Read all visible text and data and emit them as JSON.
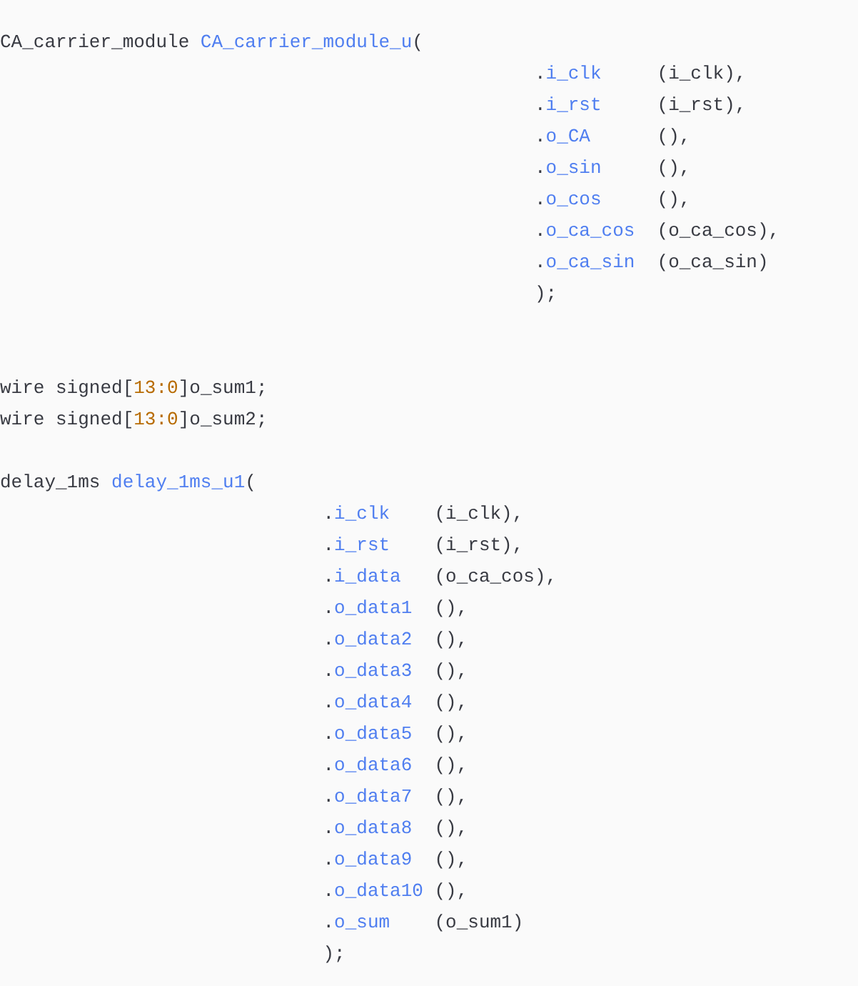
{
  "code_block": [
    {
      "kind": "instance",
      "head": [
        {
          "text": "CA_carrier_module",
          "kind": "type"
        },
        {
          "text": "CA_carrier_module_u",
          "kind": "ident"
        },
        {
          "text": "(",
          "kind": "plain"
        }
      ],
      "ports": [
        {
          "dot": ".",
          "name": "i_clk",
          "signal": "(i_clk),"
        },
        {
          "dot": ".",
          "name": "i_rst",
          "signal": "(i_rst),"
        },
        {
          "dot": ".",
          "name": "o_CA",
          "signal": "(),"
        },
        {
          "dot": ".",
          "name": "o_sin",
          "signal": "(),"
        },
        {
          "dot": ".",
          "name": "o_cos",
          "signal": "(),"
        },
        {
          "dot": ".",
          "name": "o_ca_cos",
          "signal": "(o_ca_cos),"
        },
        {
          "dot": ".",
          "name": "o_ca_sin",
          "signal": "(o_ca_sin)"
        }
      ],
      "close": ");"
    },
    {
      "kind": "blank"
    },
    {
      "kind": "blank"
    },
    {
      "kind": "line",
      "tokens": [
        {
          "text": "wire signed[",
          "kind": "plain"
        },
        {
          "text": "13:0",
          "kind": "number"
        },
        {
          "text": "]o_sum1;",
          "kind": "plain"
        }
      ]
    },
    {
      "kind": "line",
      "tokens": [
        {
          "text": "wire signed[",
          "kind": "plain"
        },
        {
          "text": "13:0",
          "kind": "number"
        },
        {
          "text": "]o_sum2;",
          "kind": "plain"
        }
      ]
    },
    {
      "kind": "blank"
    },
    {
      "kind": "instance",
      "head": [
        {
          "text": "delay_1ms",
          "kind": "type"
        },
        {
          "text": "delay_1ms_u1",
          "kind": "ident"
        },
        {
          "text": "(",
          "kind": "plain"
        }
      ],
      "ports": [
        {
          "dot": ".",
          "name": "i_clk",
          "signal": "(i_clk),"
        },
        {
          "dot": ".",
          "name": "i_rst",
          "signal": "(i_rst),"
        },
        {
          "dot": ".",
          "name": "i_data",
          "signal": "(o_ca_cos),"
        },
        {
          "dot": ".",
          "name": "o_data1",
          "signal": "(),"
        },
        {
          "dot": ".",
          "name": "o_data2",
          "signal": "(),"
        },
        {
          "dot": ".",
          "name": "o_data3",
          "signal": "(),"
        },
        {
          "dot": ".",
          "name": "o_data4",
          "signal": "(),"
        },
        {
          "dot": ".",
          "name": "o_data5",
          "signal": "(),"
        },
        {
          "dot": ".",
          "name": "o_data6",
          "signal": "(),"
        },
        {
          "dot": ".",
          "name": "o_data7",
          "signal": "(),"
        },
        {
          "dot": ".",
          "name": "o_data8",
          "signal": "(),"
        },
        {
          "dot": ".",
          "name": "o_data9",
          "signal": "(),"
        },
        {
          "dot": ".",
          "name": "o_data10",
          "signal": "(),"
        },
        {
          "dot": ".",
          "name": "o_sum",
          "signal": "(o_sum1)"
        }
      ],
      "close": ");"
    }
  ]
}
